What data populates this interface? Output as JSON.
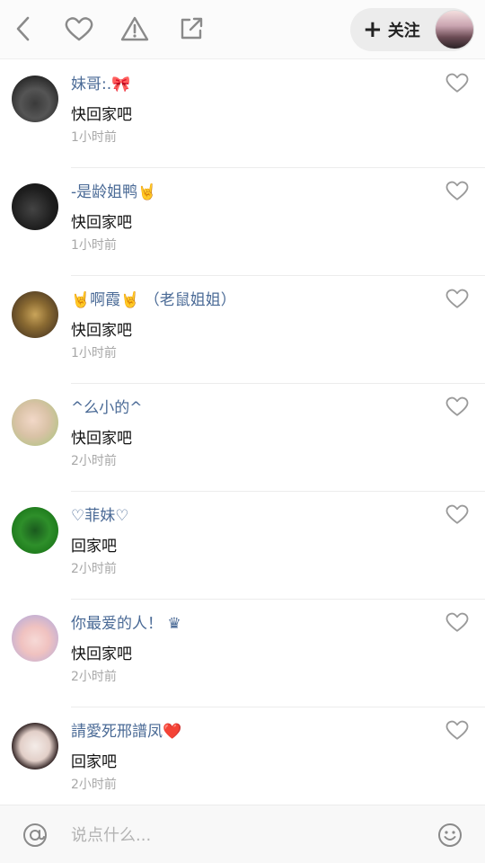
{
  "header": {
    "icons": [
      "back-icon",
      "heart-icon",
      "warning-icon",
      "share-icon"
    ],
    "follow_plus": "+",
    "follow_label": "关注"
  },
  "comments": [
    {
      "username": "妹哥:.🎀",
      "text": "快回家吧",
      "time": "1小时前"
    },
    {
      "username": "-是龄姐鸭🤘",
      "text": "快回家吧",
      "time": "1小时前"
    },
    {
      "username": "🤘啊霞🤘 （老鼠姐姐）",
      "text": "快回家吧",
      "time": "1小时前"
    },
    {
      "username": "^么小的^",
      "text": "快回家吧",
      "time": "2小时前"
    },
    {
      "username": "♡菲妹♡",
      "text": "回家吧",
      "time": "2小时前"
    },
    {
      "username": "你最爱的人！ ♛",
      "text": "快回家吧",
      "time": "2小时前"
    },
    {
      "username": "請愛死邢譜凤❤️",
      "text": "回家吧",
      "time": "2小时前"
    }
  ],
  "input": {
    "placeholder": "说点什么...",
    "value": ""
  },
  "colors": {
    "username": "#4a6a96",
    "time": "#a8a8a8",
    "icon": "#9a9a9a"
  }
}
